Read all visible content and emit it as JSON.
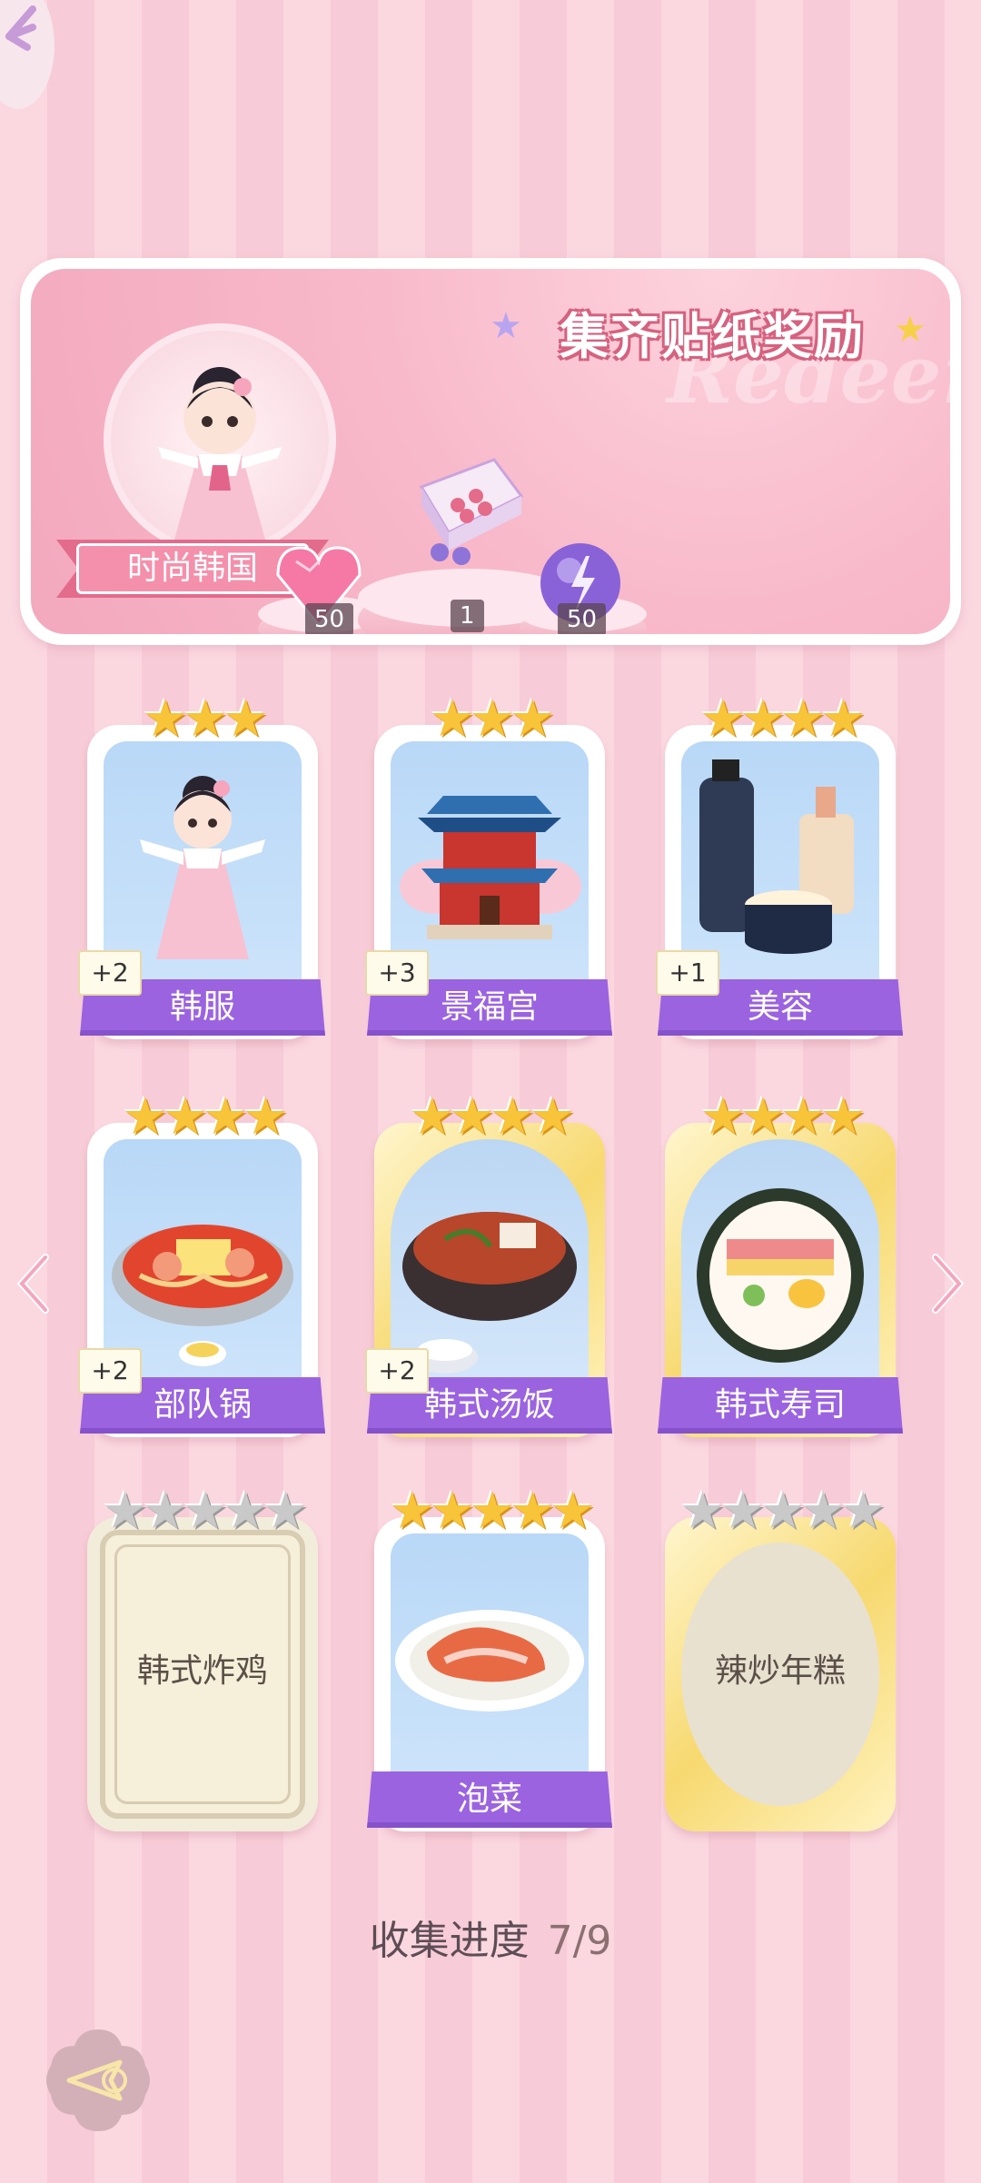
{
  "banner": {
    "title": "集齐贴纸奖励",
    "subtitle": "Redeem",
    "theme_label": "时尚韩国",
    "rewards": [
      {
        "icon": "pink-diamond-icon",
        "count": "50"
      },
      {
        "icon": "gift-box-icon",
        "count": "1"
      },
      {
        "icon": "purple-energy-orb-icon",
        "count": "50"
      }
    ]
  },
  "cards": [
    {
      "label": "韩服",
      "plus": "+2",
      "stars": 3,
      "gold": false,
      "image": "hanbok-girl"
    },
    {
      "label": "景福宫",
      "plus": "+3",
      "stars": 3,
      "gold": false,
      "image": "palace"
    },
    {
      "label": "美容",
      "plus": "+1",
      "stars": 4,
      "gold": false,
      "image": "cosmetics"
    },
    {
      "label": "部队锅",
      "plus": "+2",
      "stars": 4,
      "gold": false,
      "image": "army-stew"
    },
    {
      "label": "韩式汤饭",
      "plus": "+2",
      "stars": 4,
      "gold": true,
      "image": "soup-rice"
    },
    {
      "label": "韩式寿司",
      "plus": "",
      "stars": 4,
      "gold": true,
      "image": "kimbap"
    },
    {
      "label": "韩式炸鸡",
      "plus": "",
      "stars": 5,
      "gold": false,
      "locked": true,
      "image": ""
    },
    {
      "label": "泡菜",
      "plus": "",
      "stars": 5,
      "gold": false,
      "image": "kimchi"
    },
    {
      "label": "辣炒年糕",
      "plus": "",
      "stars": 5,
      "gold": true,
      "locked": true,
      "image": ""
    }
  ],
  "progress": {
    "label": "收集进度",
    "value": "7/9"
  },
  "colors": {
    "accent_purple": "#9b63e0",
    "pink": "#f3a8bd",
    "star_gold": "#f7c43a"
  }
}
